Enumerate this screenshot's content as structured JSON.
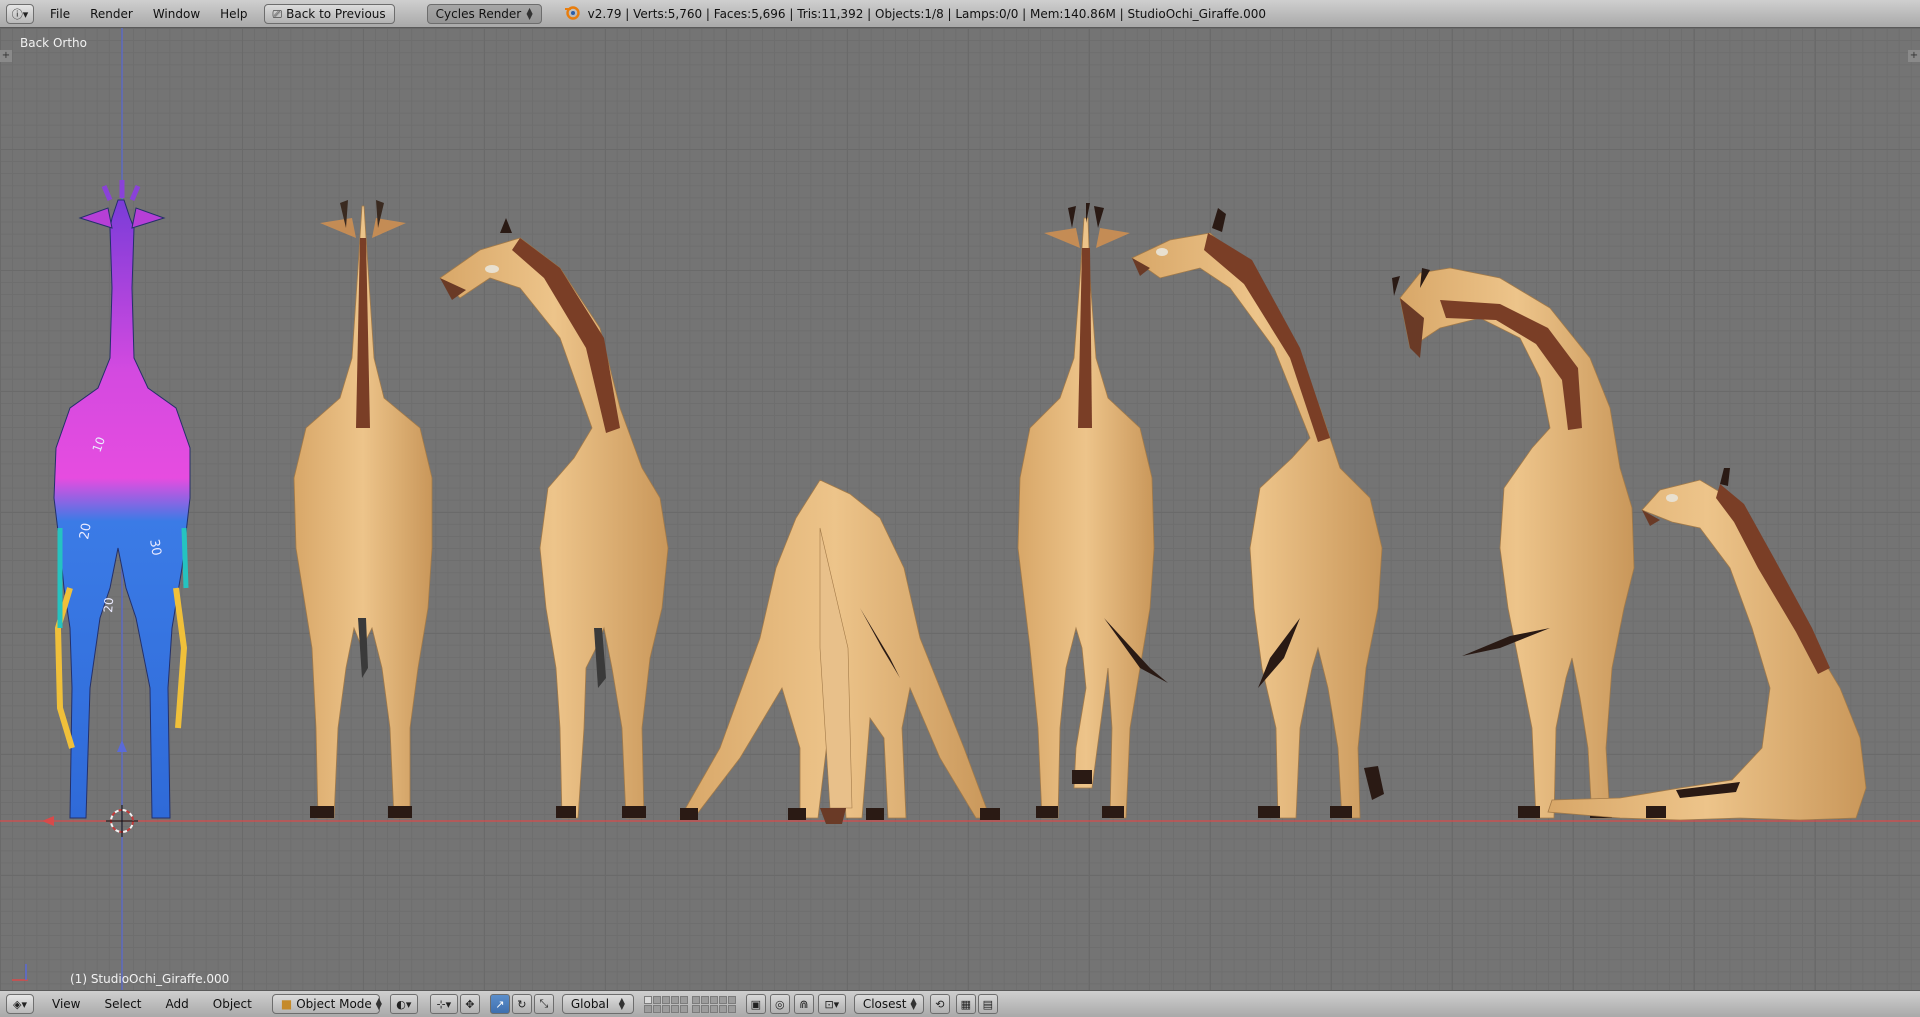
{
  "top_header": {
    "menu": [
      "File",
      "Render",
      "Window",
      "Help"
    ],
    "back_button": "Back to Previous",
    "render_engine": "Cycles Render",
    "stats": "v2.79 | Verts:5,760 | Faces:5,696 | Tris:11,392 | Objects:1/8 | Lamps:0/0 | Mem:140.86M | StudioOchi_Giraffe.000"
  },
  "viewport": {
    "view_name": "Back Ortho",
    "active_object": "(1) StudioOchi_Giraffe.000",
    "uv_numbers": [
      "10",
      "20",
      "30",
      "20"
    ]
  },
  "bottom_header": {
    "menu": [
      "View",
      "Select",
      "Add",
      "Object"
    ],
    "mode": "Object Mode",
    "transform_orientation": "Global",
    "snap_element": "Closest"
  },
  "colors": {
    "giraffe_body": "#e2b677",
    "giraffe_shade": "#c99a5c",
    "giraffe_mane": "#7a3e26",
    "hoof": "#2a1a14",
    "x_axis": "#d84a4a",
    "y_axis": "#5a6ad8",
    "grid": "#6a6a6a",
    "header": "#b9b9b9"
  },
  "icons": [
    "info-icon",
    "blender-logo-icon",
    "cube-icon",
    "shading-sphere-icon",
    "pivot-icon",
    "manipulator-icon",
    "layers-grid",
    "snap-magnet-icon",
    "render-icon"
  ]
}
